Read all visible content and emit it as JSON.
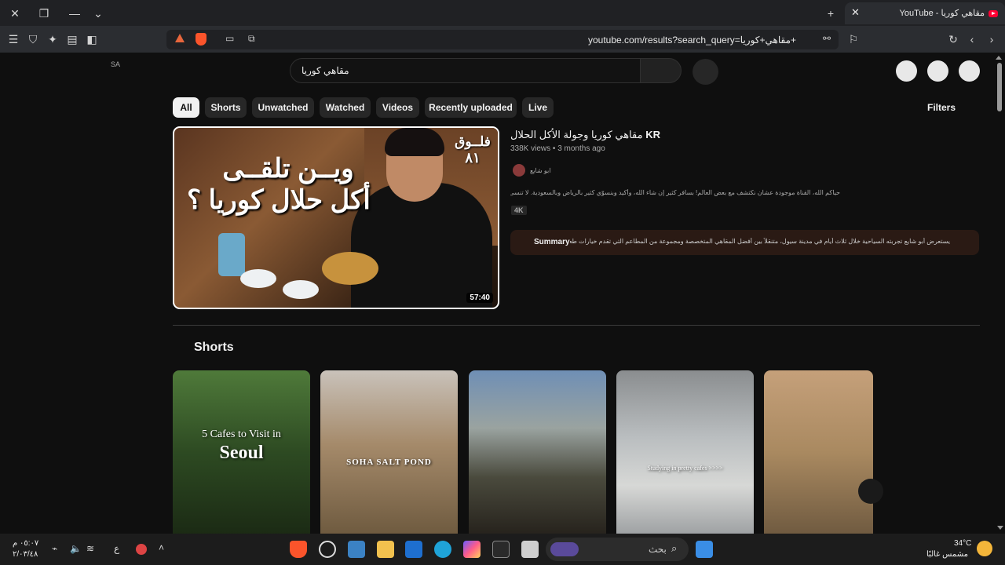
{
  "browser": {
    "tab_title": "مقاهي كوريا - YouTube",
    "url": "youtube.com/results?search_query=مقاهي+كوريا+"
  },
  "youtube": {
    "region": "SA",
    "search_query": "مقاهي كوريا",
    "chips": [
      {
        "label": "All",
        "active": true
      },
      {
        "label": "Shorts",
        "active": false
      },
      {
        "label": "Unwatched",
        "active": false
      },
      {
        "label": "Watched",
        "active": false
      },
      {
        "label": "Videos",
        "active": false
      },
      {
        "label": "Recently uploaded",
        "active": false
      },
      {
        "label": "Live",
        "active": false
      }
    ],
    "filters_label": "Filters",
    "video": {
      "title_ar": "مقاهي كوريا وجولة الأكل الحلال",
      "title_suffix": "KR",
      "views": "338K views",
      "age": "3 months ago",
      "channel": "ابو شايع",
      "description": "حياكم الله، القناة موجودة عشان نكتشف مع بعض العالم! بسافر كثير إن شاء الله، وأكيد وبنسوّي كثير بالرياض وبالسعودية. لا تنسى ...",
      "badge": "4K",
      "duration": "57:40",
      "thumb_title_line1": "ويــن تلقــى",
      "thumb_title_line2": "أكل حلال كوريا ؟",
      "thumb_vlog": "فلــوق",
      "thumb_number": "٨١",
      "summary_label": "Summary",
      "summary_text": "يستعرض أبو شايع تجربته السياحية خلال ثلاث أيام في مدينة سيول، متنقلاً بين أفضل المقاهي المتخصصة ومجموعة من المطاعم التي تقدم خيارات طعام..."
    },
    "shorts_heading": "Shorts",
    "shorts": [
      {
        "overlay_line1": "5 Cafes to Visit in",
        "overlay_line2": "Seoul"
      },
      {
        "overlay_line1": "SOHA SALT POND",
        "overlay_line2": ""
      },
      {
        "overlay_line1": "",
        "overlay_line2": ""
      },
      {
        "overlay_line1": "Studying in pretty cafes >>>>",
        "overlay_line2": ""
      },
      {
        "overlay_line1": "",
        "overlay_line2": ""
      }
    ]
  },
  "taskbar": {
    "search_placeholder": "بحث",
    "time": "٠٥:٠٧ م",
    "date": "٢/٠٣/٤٨",
    "language": "ع",
    "weather_temp": "34°C",
    "weather_condition": "مشمس غالبًا"
  }
}
